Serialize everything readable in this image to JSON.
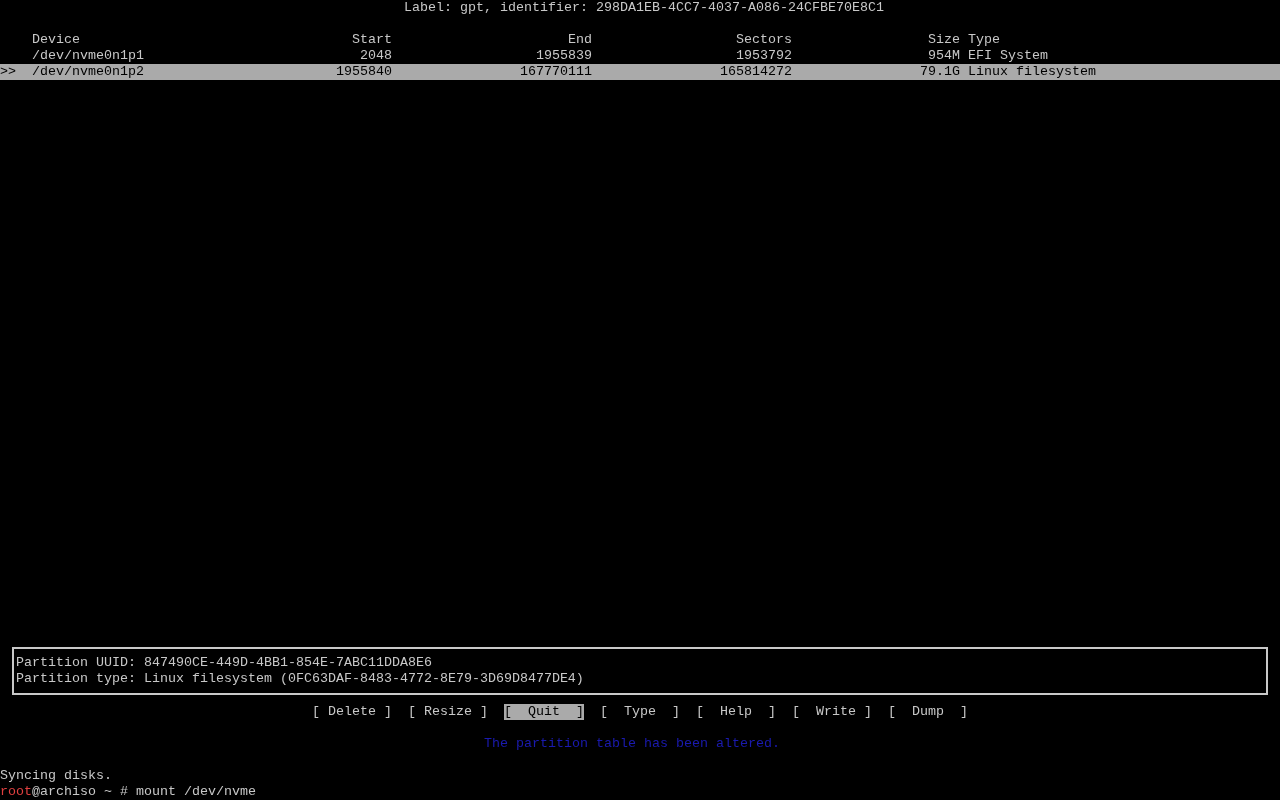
{
  "disk_label": "Label: gpt, identifier: 298DA1EB-4CC7-4037-A086-24CFBE70E8C1",
  "table": {
    "columns": [
      "Device",
      "Start",
      "End",
      "Sectors",
      "Size",
      "Type"
    ],
    "rows": [
      {
        "cells": [
          "/dev/nvme0n1p1",
          "2048",
          "1955839",
          "1953792",
          "954M",
          "EFI System"
        ],
        "selected": false,
        "cursor": ""
      },
      {
        "cells": [
          "/dev/nvme0n1p2",
          "1955840",
          "167770111",
          "165814272",
          "79.1G",
          "Linux filesystem"
        ],
        "selected": true,
        "cursor": ">>"
      }
    ]
  },
  "info_panel": [
    "Partition UUID: 847490CE-449D-4BB1-854E-7ABC11DDA8E6",
    "Partition type: Linux filesystem (0FC63DAF-8483-4772-8E79-3D69D8477DE4)"
  ],
  "menu": [
    {
      "label": "[ Delete ]",
      "selected": false
    },
    {
      "label": "[ Resize ]",
      "selected": false
    },
    {
      "label": "[  Quit  ]",
      "selected": true
    },
    {
      "label": "[  Type  ]",
      "selected": false
    },
    {
      "label": "[  Help  ]",
      "selected": false
    },
    {
      "label": "[  Write ]",
      "selected": false
    },
    {
      "label": "[  Dump  ]",
      "selected": false
    }
  ],
  "message": "The partition table has been altered.",
  "output": "Syncing disks.",
  "prompt": {
    "user": "root",
    "rest": "@archiso ~ # mount /dev/nvme"
  }
}
